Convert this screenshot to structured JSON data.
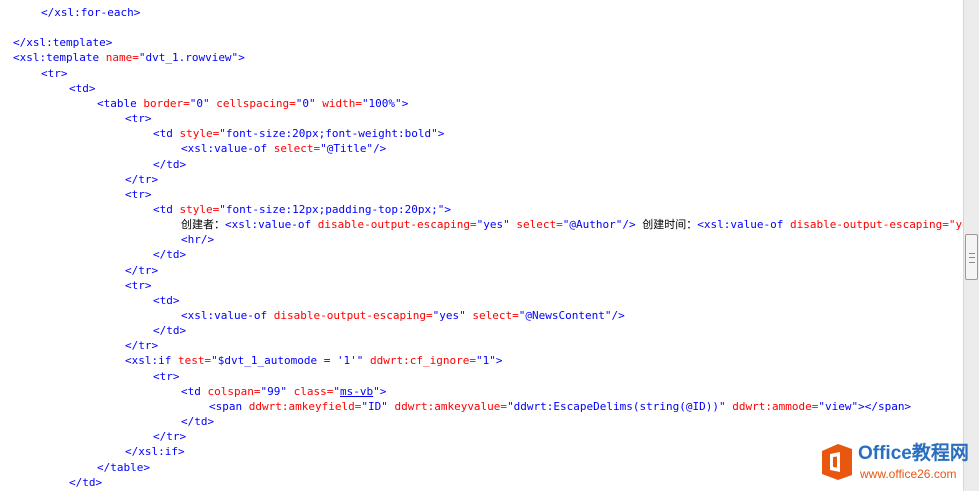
{
  "code_lines": [
    [
      "</xsl:for-each>"
    ],
    [],
    [
      "</xsl:template>"
    ],
    [
      "<xsl:template",
      " name=",
      "\"dvt_1.rowview\"",
      ">"
    ],
    [
      "<tr>"
    ],
    [
      "<td>"
    ],
    [
      "<table",
      " border=",
      "\"0\"",
      " cellspacing=",
      "\"0\"",
      " width=",
      "\"100%\"",
      ">"
    ],
    [
      "<tr>"
    ],
    [
      "<td",
      " style=",
      "\"font-size:20px;font-weight:bold\"",
      ">"
    ],
    [
      "<xsl:value-of",
      " select=",
      "\"@Title\"",
      "/>"
    ],
    [
      "</td>"
    ],
    [
      "</tr>"
    ],
    [
      "<tr>"
    ],
    [
      "<td",
      " style=",
      "\"font-size:12px;padding-top:20px;\"",
      ">"
    ],
    [
      "创建者：",
      "<xsl:value-of",
      " disable-output-escaping=",
      "\"yes\"",
      " select=",
      "\"@Author\"",
      "/>",
      " 创建时间：",
      "<xsl:value-of",
      " disable-output-escaping=\"yes\" select=\"@Created\"/>"
    ],
    [
      "<hr/>"
    ],
    [
      "</td>"
    ],
    [
      "</tr>"
    ],
    [
      "<tr>"
    ],
    [
      "<td>"
    ],
    [
      "<xsl:value-of",
      " disable-output-escaping=",
      "\"yes\"",
      " select=",
      "\"@NewsContent\"",
      "/>"
    ],
    [
      "</td>"
    ],
    [
      "</tr>"
    ],
    [
      "<xsl:if",
      " test=",
      "\"$dvt_1_automode = '1'\"",
      " ddwrt:cf_ignore=",
      "\"1\"",
      ">"
    ],
    [
      "<tr>"
    ],
    [
      "<td",
      " colspan=",
      "\"99\"",
      " class=",
      "\"",
      "ms-vb",
      "\"",
      ">"
    ],
    [
      "<span",
      " ddwrt:amkeyfield=",
      "\"ID\"",
      " ddwrt:amkeyvalue=",
      "\"ddwrt:EscapeDelims(string(@ID))\"",
      " ddwrt:ammode=",
      "\"view\"",
      "></span>"
    ],
    [
      "</td>"
    ],
    [
      "</tr>"
    ],
    [
      "</xsl:if>"
    ],
    [
      "</table>"
    ],
    [
      "</td>"
    ]
  ],
  "watermark": {
    "brand": "Office教程网",
    "url": "www.office26.com"
  }
}
